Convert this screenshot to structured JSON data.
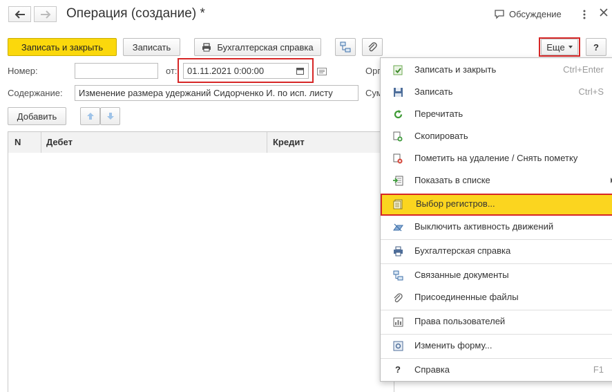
{
  "header": {
    "title": "Операция (создание) *",
    "discussion_label": "Обсуждение"
  },
  "toolbar": {
    "save_close": "Записать и закрыть",
    "save": "Записать",
    "print_ref": "Бухгалтерская справка",
    "more": "Еще",
    "help": "?"
  },
  "form": {
    "number_label": "Номер:",
    "number_value": "",
    "from_label": "от:",
    "date_value": "01.11.2021  0:00:00",
    "org_label_partial": "Орг",
    "content_label": "Содержание:",
    "content_value": "Изменение размера удержаний Сидорченко И. по исп. листу",
    "sum_label_partial": "Сум",
    "add_button": "Добавить"
  },
  "table": {
    "columns": [
      "N",
      "Дебет",
      "Кредит"
    ]
  },
  "menu": {
    "items": [
      {
        "label": "Записать и закрыть",
        "shortcut": "Ctrl+Enter",
        "icon": "save-close-icon"
      },
      {
        "label": "Записать",
        "shortcut": "Ctrl+S",
        "icon": "floppy-icon"
      },
      {
        "label": "Перечитать",
        "shortcut": "",
        "icon": "refresh-icon"
      },
      {
        "label": "Скопировать",
        "shortcut": "",
        "icon": "copy-icon"
      },
      {
        "label": "Пометить на удаление / Снять пометку",
        "shortcut": "",
        "icon": "mark-delete-icon"
      },
      {
        "label": "Показать в списке",
        "shortcut": "",
        "icon": "show-in-list-icon"
      },
      {
        "label": "Выбор регистров...",
        "shortcut": "",
        "icon": "registers-icon"
      },
      {
        "label": "Выключить активность движений",
        "shortcut": "",
        "icon": "deactivate-icon"
      },
      {
        "label": "Бухгалтерская справка",
        "shortcut": "",
        "icon": "printer-icon"
      },
      {
        "label": "Связанные документы",
        "shortcut": "",
        "icon": "structure-icon"
      },
      {
        "label": "Присоединенные файлы",
        "shortcut": "",
        "icon": "paperclip-icon"
      },
      {
        "label": "Права пользователей",
        "shortcut": "",
        "icon": "rights-icon"
      },
      {
        "label": "Изменить форму...",
        "shortcut": "",
        "icon": "form-settings-icon"
      },
      {
        "label": "Справка",
        "shortcut": "F1",
        "icon": "help-icon"
      }
    ]
  },
  "colors": {
    "accent_yellow": "#fbd80c",
    "highlight_red": "#d62626"
  }
}
